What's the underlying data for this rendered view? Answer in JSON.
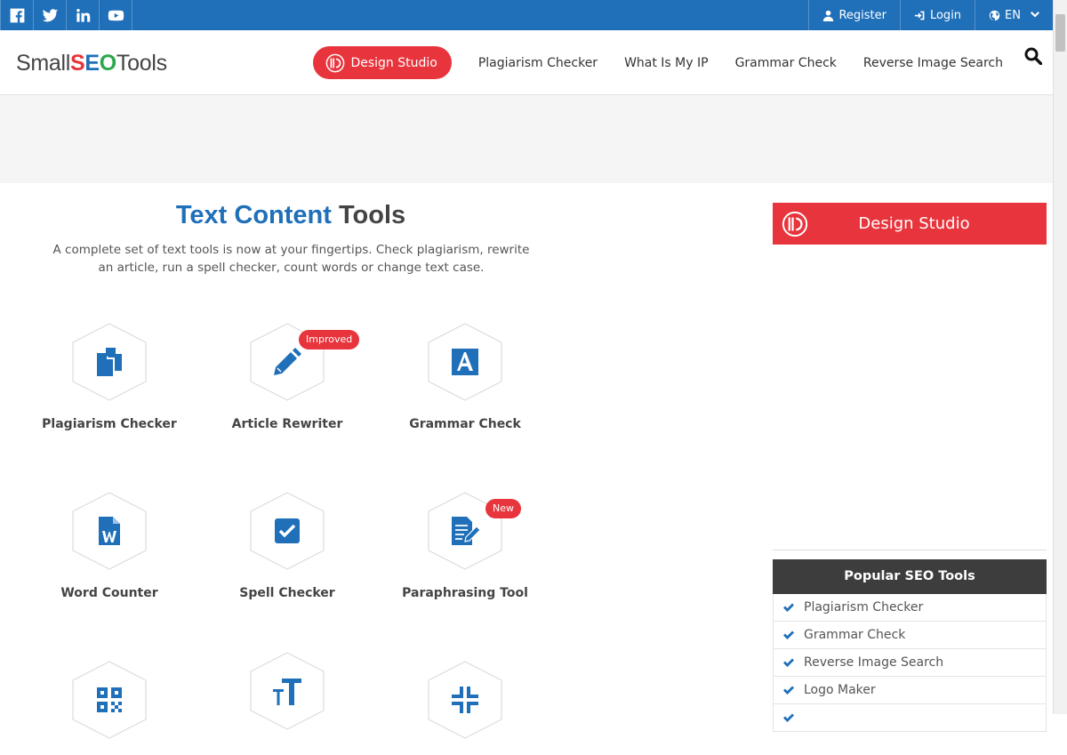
{
  "colors": {
    "brand_blue": "#1f6fb9",
    "accent_red": "#e8343c",
    "dark_header": "#3d3d3d"
  },
  "topbar": {
    "social_icons": [
      "facebook-icon",
      "twitter-icon",
      "linkedin-icon",
      "youtube-icon"
    ],
    "register_label": "Register",
    "login_label": "Login",
    "language": "EN"
  },
  "header": {
    "logo": {
      "small": "Small",
      "seo_s": "S",
      "seo_e": "E",
      "seo_o": "O",
      "tools": "Tools"
    },
    "nav": {
      "design_studio": "Design Studio",
      "items": [
        "Plagiarism Checker",
        "What Is My IP",
        "Grammar Check",
        "Reverse Image Search"
      ]
    }
  },
  "main": {
    "title_a": "Text Content",
    "title_b": "Tools",
    "subtitle": "A complete set of text tools is now at your fingertips. Check plagiarism, rewrite an article, run a spell checker, count words or change text case.",
    "tools": [
      {
        "label": "Plagiarism Checker",
        "icon": "documents-icon",
        "badge": ""
      },
      {
        "label": "Article Rewriter",
        "icon": "pencil-icon",
        "badge": "Improved"
      },
      {
        "label": "Grammar Check",
        "icon": "letter-a-icon",
        "badge": ""
      },
      {
        "label": "Word Counter",
        "icon": "word-document-icon",
        "badge": ""
      },
      {
        "label": "Spell Checker",
        "icon": "checkbox-icon",
        "badge": ""
      },
      {
        "label": "Paraphrasing Tool",
        "icon": "edit-document-icon",
        "badge": "New"
      },
      {
        "label": "",
        "icon": "qr-code-icon",
        "badge": ""
      },
      {
        "label": "",
        "icon": "text-size-icon",
        "badge": ""
      },
      {
        "label": "",
        "icon": "compress-icon",
        "badge": ""
      }
    ]
  },
  "sidebar": {
    "design_studio_banner": "Design Studio",
    "popular_title": "Popular SEO Tools",
    "popular_items": [
      "Plagiarism Checker",
      "Grammar Check",
      "Reverse Image Search",
      "Logo Maker"
    ]
  }
}
